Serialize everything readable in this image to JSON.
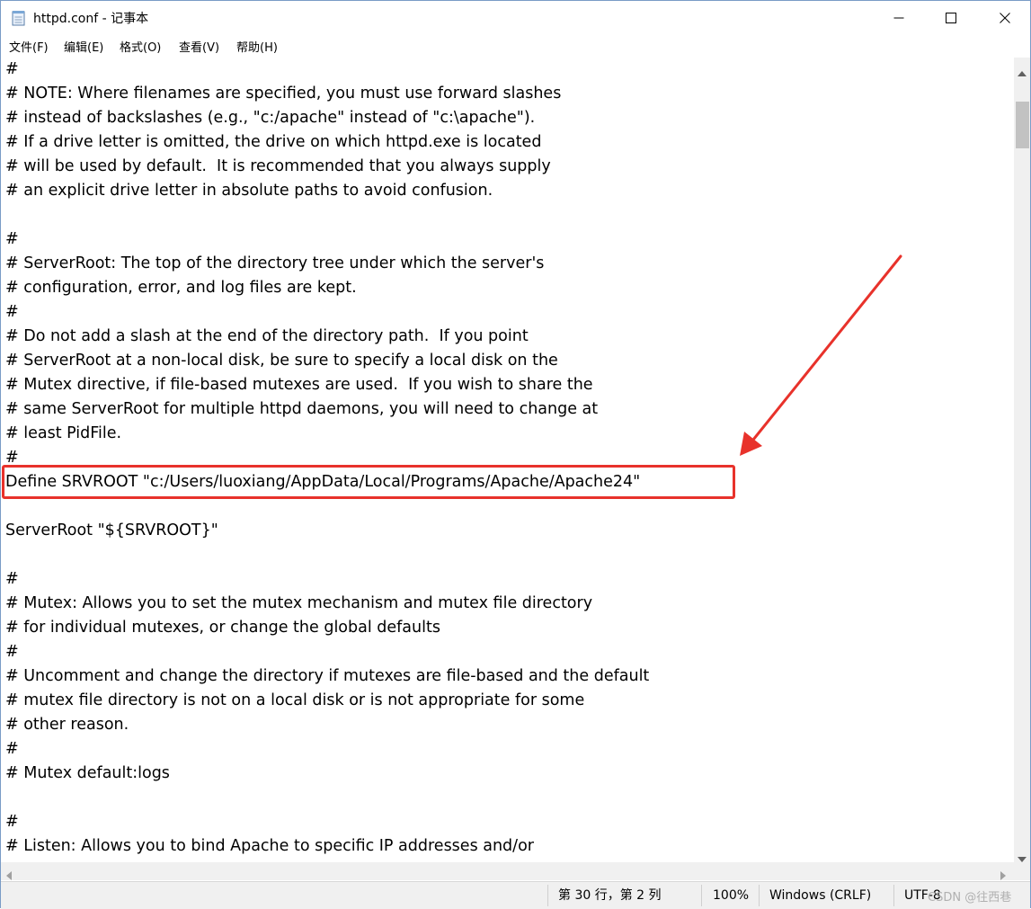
{
  "window": {
    "title": "httpd.conf - 记事本"
  },
  "menu": [
    {
      "label": "文件(F)"
    },
    {
      "label": "编辑(E)"
    },
    {
      "label": "格式(O)"
    },
    {
      "label": "查看(V)"
    },
    {
      "label": "帮助(H)"
    }
  ],
  "editor": {
    "lines": [
      "#",
      "# NOTE: Where filenames are specified, you must use forward slashes",
      "# instead of backslashes (e.g., \"c:/apache\" instead of \"c:\\apache\").",
      "# If a drive letter is omitted, the drive on which httpd.exe is located",
      "# will be used by default.  It is recommended that you always supply",
      "# an explicit drive letter in absolute paths to avoid confusion.",
      "",
      "#",
      "# ServerRoot: The top of the directory tree under which the server's",
      "# configuration, error, and log files are kept.",
      "#",
      "# Do not add a slash at the end of the directory path.  If you point",
      "# ServerRoot at a non-local disk, be sure to specify a local disk on the",
      "# Mutex directive, if file-based mutexes are used.  If you wish to share the",
      "# same ServerRoot for multiple httpd daemons, you will need to change at",
      "# least PidFile.",
      "#",
      "Define SRVROOT \"c:/Users/luoxiang/AppData/Local/Programs/Apache/Apache24\"",
      "",
      "ServerRoot \"${SRVROOT}\"",
      "",
      "#",
      "# Mutex: Allows you to set the mutex mechanism and mutex file directory",
      "# for individual mutexes, or change the global defaults",
      "#",
      "# Uncomment and change the directory if mutexes are file-based and the default",
      "# mutex file directory is not on a local disk or is not appropriate for some",
      "# other reason.",
      "#",
      "# Mutex default:logs",
      "",
      "#",
      "# Listen: Allows you to bind Apache to specific IP addresses and/or"
    ]
  },
  "status": {
    "position": "第 30 行，第 2 列",
    "zoom": "100%",
    "line_ending": "Windows (CRLF)",
    "encoding": "UTF-8"
  },
  "watermark": "CSDN @往西巷",
  "colors": {
    "annotation": "#e8322b"
  }
}
